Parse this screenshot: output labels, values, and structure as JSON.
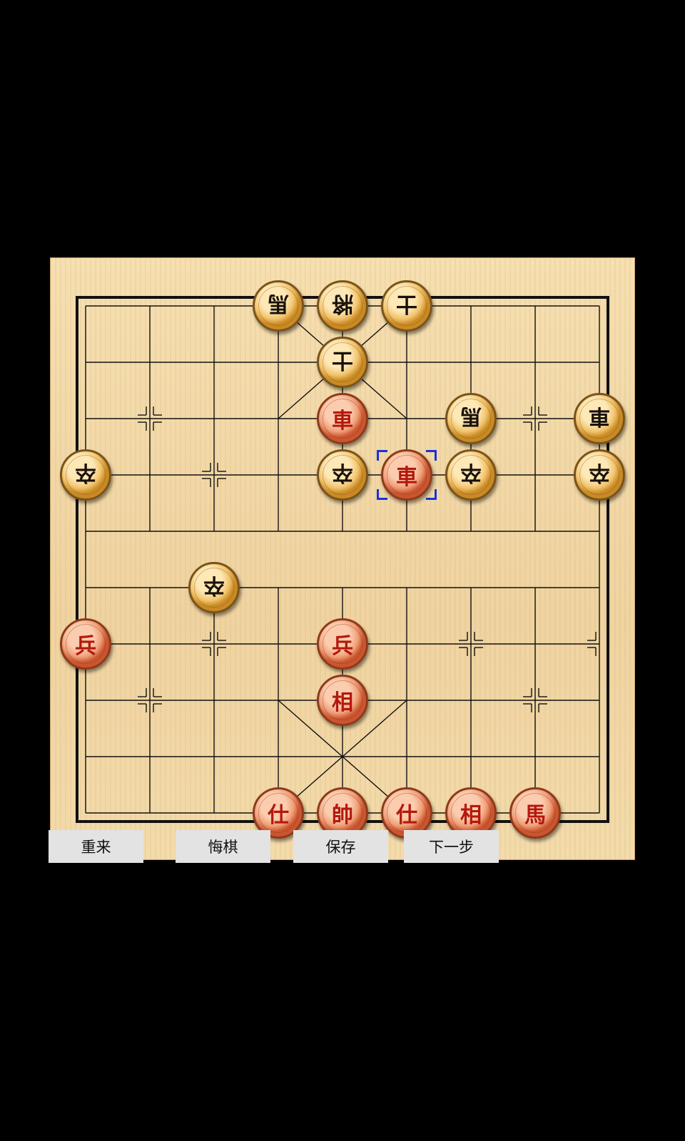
{
  "board": {
    "river_left": "",
    "river_right": "",
    "selected": {
      "col": 5,
      "row": 3
    },
    "pieces": [
      {
        "side": "black",
        "label": "馬",
        "col": 3,
        "row": 0
      },
      {
        "side": "black",
        "label": "將",
        "col": 4,
        "row": 0
      },
      {
        "side": "black",
        "label": "士",
        "col": 5,
        "row": 0
      },
      {
        "side": "black",
        "label": "士",
        "col": 4,
        "row": 1
      },
      {
        "side": "red",
        "label": "車",
        "col": 4,
        "row": 2
      },
      {
        "side": "black",
        "label": "馬",
        "col": 6,
        "row": 2
      },
      {
        "side": "black",
        "label": "車",
        "col": 8,
        "row": 2
      },
      {
        "side": "black",
        "label": "卒",
        "col": 0,
        "row": 3
      },
      {
        "side": "black",
        "label": "卒",
        "col": 4,
        "row": 3
      },
      {
        "side": "red",
        "label": "車",
        "col": 5,
        "row": 3
      },
      {
        "side": "black",
        "label": "卒",
        "col": 6,
        "row": 3
      },
      {
        "side": "black",
        "label": "卒",
        "col": 8,
        "row": 3
      },
      {
        "side": "black",
        "label": "卒",
        "col": 2,
        "row": 5
      },
      {
        "side": "red",
        "label": "兵",
        "col": 0,
        "row": 6
      },
      {
        "side": "red",
        "label": "兵",
        "col": 4,
        "row": 6
      },
      {
        "side": "red",
        "label": "相",
        "col": 4,
        "row": 7
      },
      {
        "side": "red",
        "label": "仕",
        "col": 3,
        "row": 9
      },
      {
        "side": "red",
        "label": "帥",
        "col": 4,
        "row": 9
      },
      {
        "side": "red",
        "label": "仕",
        "col": 5,
        "row": 9
      },
      {
        "side": "red",
        "label": "相",
        "col": 6,
        "row": 9
      },
      {
        "side": "red",
        "label": "馬",
        "col": 7,
        "row": 9
      }
    ]
  },
  "buttons": {
    "restart": "重来",
    "undo": "悔棋",
    "save": "保存",
    "next": "下一步"
  },
  "colors": {
    "board_wood": "#f3d9a8",
    "grid_line": "#111111",
    "red_text": "#b4180e",
    "black_text": "#1a1108",
    "selection": "#1733d8",
    "button_bg": "#e3e3e3",
    "background": "#000000"
  }
}
